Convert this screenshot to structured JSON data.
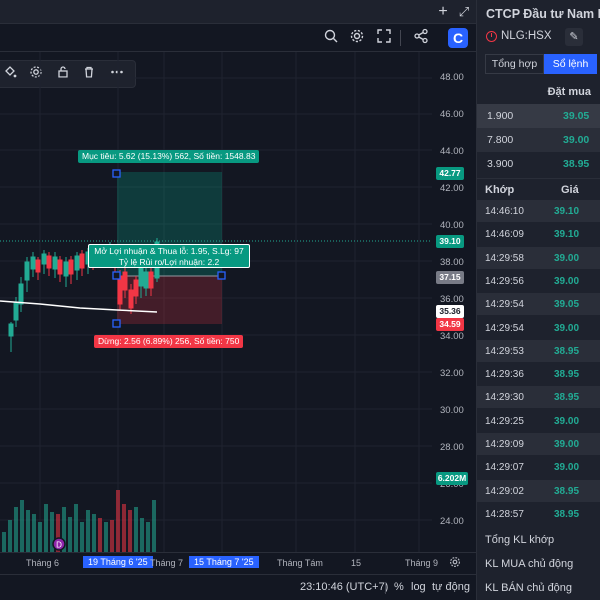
{
  "top_bar": {
    "add_label": "+",
    "expand_label": "⤢"
  },
  "chart": {
    "price_ticks": [
      "48.00",
      "46.00",
      "44.00",
      "42.00",
      "40.00",
      "38.00",
      "36.00",
      "34.00",
      "32.00",
      "30.00",
      "28.00",
      "26.00",
      "24.00"
    ],
    "time_ticks": [
      "Tháng 6",
      "Tháng 7",
      "Tháng Tám",
      "15",
      "Tháng 9"
    ],
    "time_highlights": [
      "19 Tháng 6 '25",
      "15 Tháng 7 '25"
    ],
    "target_label": "Mục tiêu: 5.62 (15.13%) 562, Số tiền: 1548.83",
    "stop_label": "Dừng: 2.56 (6.89%) 256, Số tiền: 750",
    "rr_line1": "Mở Lợi nhuận & Thua lỗ: 1.95, S.Lg: 97",
    "rr_line2": "Tỷ lệ Rủi ro/Lợi nhuận: 2.2",
    "price_tags": {
      "target": "42.77",
      "last": "39.10",
      "entry": "37.15",
      "line": "35.36",
      "stop": "34.59",
      "volume": "6.202M"
    },
    "colors": {
      "up": "#22ab94",
      "down": "#f23645",
      "accent": "#2962ff"
    },
    "event_badge": "D"
  },
  "status": {
    "time": "23:10:46 (UTC+7)",
    "percent": "%",
    "log": "log",
    "auto": "tự động"
  },
  "panel": {
    "company": "CTCP Đầu tư Nam Lo",
    "symbol": "NLG:HSX",
    "tabs": {
      "overview": "Tổng hợp",
      "orders": "Sổ lệnh"
    },
    "orderbook_header": "Đặt mua",
    "orderbook": [
      {
        "vol": "1.900",
        "price": "39.05"
      },
      {
        "vol": "7.800",
        "price": "39.00"
      },
      {
        "vol": "3.900",
        "price": "38.95"
      }
    ],
    "match_header": {
      "time": "Khớp",
      "price": "Giá"
    },
    "matches": [
      {
        "time": "14:46:10",
        "price": "39.10"
      },
      {
        "time": "14:46:09",
        "price": "39.10"
      },
      {
        "time": "14:29:58",
        "price": "39.00"
      },
      {
        "time": "14:29:56",
        "price": "39.00"
      },
      {
        "time": "14:29:54",
        "price": "39.05"
      },
      {
        "time": "14:29:54",
        "price": "39.00"
      },
      {
        "time": "14:29:53",
        "price": "38.95"
      },
      {
        "time": "14:29:36",
        "price": "38.95"
      },
      {
        "time": "14:29:30",
        "price": "38.95"
      },
      {
        "time": "14:29:25",
        "price": "39.00"
      },
      {
        "time": "14:29:09",
        "price": "39.00"
      },
      {
        "time": "14:29:07",
        "price": "39.00"
      },
      {
        "time": "14:29:02",
        "price": "38.95"
      },
      {
        "time": "14:28:57",
        "price": "38.95"
      }
    ],
    "links": {
      "kl_khop": "Tổng KL khớp",
      "kl_mua": "KL MUA chủ động",
      "kl_ban": "KL BÁN chủ động"
    }
  }
}
